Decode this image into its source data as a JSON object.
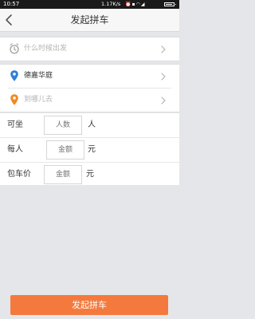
{
  "status_bar": {
    "time": "10:57",
    "net_speed": "1.17K/s",
    "icons": [
      "alarm-icon",
      "sim-icon",
      "wifi-icon",
      "signal-icon",
      "battery-icon"
    ]
  },
  "header": {
    "title": "发起拼车",
    "back_icon": "chevron-left-icon"
  },
  "trip": {
    "departure_time_placeholder": "什么时候出发",
    "origin": "德嘉华庭",
    "destination_placeholder": "到哪儿去"
  },
  "form": {
    "seats": {
      "label": "可坐",
      "placeholder": "人数",
      "unit": "人"
    },
    "price_per_person": {
      "label": "每人",
      "placeholder": "金额",
      "unit": "元"
    },
    "charter_price": {
      "label": "包车价",
      "placeholder": "金额",
      "unit": "元"
    }
  },
  "submit_label": "发起拼车",
  "colors": {
    "accent": "#f4793c",
    "origin_pin": "#2f7fd6",
    "destination_pin": "#f08a24",
    "page_bg": "#e4e6e9"
  }
}
